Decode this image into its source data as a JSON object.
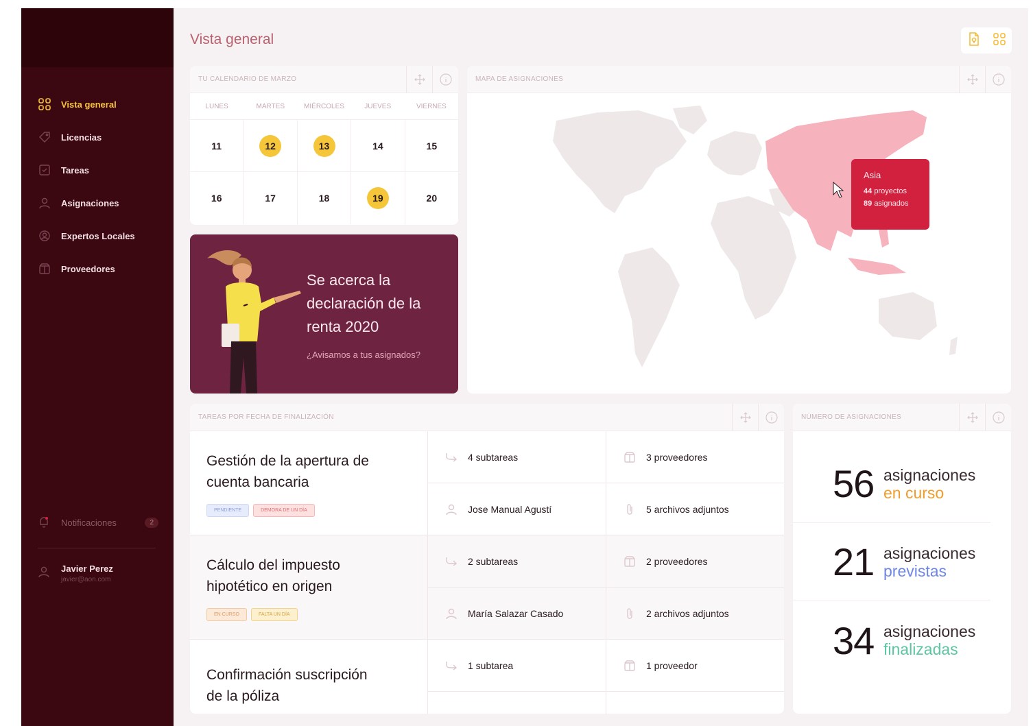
{
  "colors": {
    "sidebar": "#3b0711",
    "accent": "#f5c23d",
    "map_highlight": "#f6b3bd",
    "tooltip": "#d2203f",
    "orange": "#f39c2c",
    "blue": "#6e86e6",
    "green": "#5cc6a0"
  },
  "sidebar": {
    "items": [
      {
        "label": "Vista general",
        "icon": "grid-icon"
      },
      {
        "label": "Licencias",
        "icon": "tag-icon"
      },
      {
        "label": "Tareas",
        "icon": "task-icon"
      },
      {
        "label": "Asignaciones",
        "icon": "user-icon"
      },
      {
        "label": "Expertos Locales",
        "icon": "badge-icon"
      },
      {
        "label": "Proveedores",
        "icon": "box-icon"
      }
    ],
    "notifications": {
      "label": "Notificaciones",
      "count": "2"
    },
    "user": {
      "name": "Javier Perez",
      "email": "javier@aon.com"
    }
  },
  "header": {
    "title": "Vista general"
  },
  "calendar": {
    "title": "Tu calendario de marzo",
    "days": [
      "LUNES",
      "MARTES",
      "MIÉRCOLES",
      "JUEVES",
      "VIERNES"
    ],
    "week1": [
      "11",
      "12",
      "13",
      "14",
      "15"
    ],
    "week2": [
      "16",
      "17",
      "18",
      "19",
      "20"
    ]
  },
  "promo": {
    "text": "Se acerca la declaración de la renta 2020",
    "link": "¿Avisamos a tus asignados?"
  },
  "map": {
    "title": "Mapa de asignaciones",
    "tooltip": {
      "region": "Asia",
      "projects_num": "44",
      "projects_label": "proyectos",
      "assigned_num": "89",
      "assigned_label": "asignados"
    }
  },
  "tasks": {
    "title": "Tareas por fecha de finalización",
    "rows": [
      {
        "title": "Gestión de la apertura de cuenta bancaria",
        "tags": [
          "PENDIENTE",
          "DEMORA DE UN DÍA"
        ],
        "subtasks": "4 subtareas",
        "providers": "3 proveedores",
        "person": "Jose Manual Agustí",
        "files": "5 archivos adjuntos"
      },
      {
        "title": "Cálculo del impuesto hipotético en origen",
        "tags": [
          "EN CURSO",
          "FALTA UN DÍA"
        ],
        "subtasks": "2 subtareas",
        "providers": "2 proveedores",
        "person": "María Salazar Casado",
        "files": "2 archivos adjuntos"
      },
      {
        "title": "Confirmación suscripción de la póliza",
        "subtasks": "1 subtarea",
        "providers": "1 proveedor"
      }
    ]
  },
  "stats": {
    "title": "Número de asignaciones",
    "items": [
      {
        "num": "56",
        "label": "asignaciones",
        "status": "en curso",
        "color": "#f39c2c"
      },
      {
        "num": "21",
        "label": "asignaciones",
        "status": "previstas",
        "color": "#6e86e6"
      },
      {
        "num": "34",
        "label": "asignaciones",
        "status": "finalizadas",
        "color": "#5cc6a0"
      }
    ]
  }
}
